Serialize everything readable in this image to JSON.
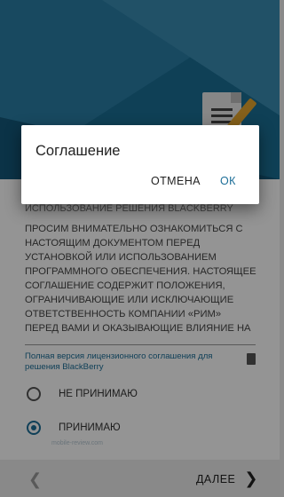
{
  "dialog": {
    "title": "Соглашение",
    "cancel_label": "ОТМЕНА",
    "ok_label": "ОК"
  },
  "license": {
    "subtitle": "ИСПОЛЬЗОВАНИЕ РЕШЕНИЯ BLACKBERRY",
    "body": "ПРОСИМ ВНИМАТЕЛЬНО ОЗНАКОМИТЬСЯ С НАСТОЯЩИМ ДОКУМЕНТОМ ПЕРЕД УСТАНОВКОЙ ИЛИ ИСПОЛЬЗОВАНИЕМ ПРОГРАММНОГО ОБЕСПЕЧЕНИЯ. НАСТОЯЩЕЕ СОГЛАШЕНИЕ СОДЕРЖИТ ПОЛОЖЕНИЯ, ОГРАНИЧИВАЮЩИЕ ИЛИ ИСКЛЮЧАЮЩИЕ ОТВЕТСТВЕННОСТЬ КОМПАНИИ «РИМ» ПЕРЕД ВАМИ И ОКАЗЫВАЮЩИЕ ВЛИЯНИЕ НА ВАШИ ЗАКОННЫЕ ПРАВА. В ЗАВИСИМОСТИ ОТ ВАШЕЙ ЮРИСДИКЦИИ ПОЛОЖЕНИЯМИ НАСТОЯЩЕГО",
    "full_version_link": "Полная версия лицензионного соглашения для решения BlackBerry"
  },
  "options": {
    "decline_label": "НЕ ПРИНИМАЮ",
    "accept_label": "ПРИНИМАЮ",
    "selected": "accept"
  },
  "bottom_bar": {
    "next_label": "ДАЛЕЕ"
  },
  "icons": {
    "back": "chevron-left-icon",
    "next": "chevron-right-icon",
    "document": "document-icon",
    "pencil": "pencil-icon",
    "file": "file-icon"
  },
  "colors": {
    "accent": "#1c6e98",
    "header": "#1b6f95"
  },
  "watermark": "mobile-review.com"
}
